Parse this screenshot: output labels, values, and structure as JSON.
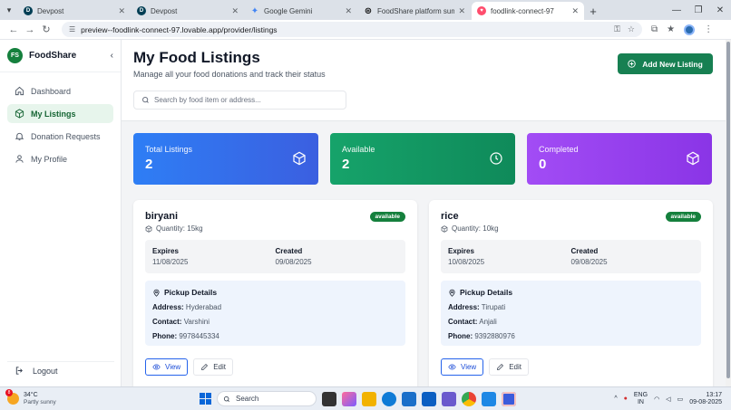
{
  "browser": {
    "tabs": [
      {
        "label": "Devpost",
        "icon": "devpost-icon",
        "color": "#003e54",
        "active": false
      },
      {
        "label": "Devpost",
        "icon": "devpost-icon",
        "color": "#003e54",
        "active": false
      },
      {
        "label": "Google Gemini",
        "icon": "gemini-icon",
        "color": "#4285f4",
        "active": false
      },
      {
        "label": "FoodShare platform summary",
        "icon": "chatgpt-icon",
        "color": "#111111",
        "active": false
      },
      {
        "label": "foodlink-connect-97",
        "icon": "lovable-icon",
        "color": "#ff4d6d",
        "active": true
      }
    ],
    "url": "preview--foodlink-connect-97.lovable.app/provider/listings"
  },
  "sidebar": {
    "brand_initials": "FS",
    "brand_name": "FoodShare",
    "items": [
      {
        "label": "Dashboard",
        "icon": "home-icon",
        "active": false
      },
      {
        "label": "My Listings",
        "icon": "box-icon",
        "active": true
      },
      {
        "label": "Donation Requests",
        "icon": "bell-icon",
        "active": false
      },
      {
        "label": "My Profile",
        "icon": "user-icon",
        "active": false
      }
    ],
    "logout_label": "Logout"
  },
  "header": {
    "title": "My Food Listings",
    "subtitle": "Manage all your food donations and track their status",
    "add_button_label": "Add New Listing",
    "search_placeholder": "Search by food item or address..."
  },
  "stats": [
    {
      "label": "Total Listings",
      "value": "2",
      "icon": "box-icon",
      "color": "#2e7ef5"
    },
    {
      "label": "Available",
      "value": "2",
      "icon": "clock-icon",
      "color": "#16a36a"
    },
    {
      "label": "Completed",
      "value": "0",
      "icon": "box-icon",
      "color": "#a24cf5"
    }
  ],
  "listings": [
    {
      "title": "biryani",
      "status": "available",
      "quantity": "Quantity: 15kg",
      "expires_label": "Expires",
      "expires": "11/08/2025",
      "created_label": "Created",
      "created": "09/08/2025",
      "pickup_heading": "Pickup Details",
      "address_label": "Address:",
      "address": "Hyderabad",
      "contact_label": "Contact:",
      "contact": "Varshini",
      "phone_label": "Phone:",
      "phone": "9978445334",
      "view_label": "View",
      "edit_label": "Edit"
    },
    {
      "title": "rice",
      "status": "available",
      "quantity": "Quantity: 10kg",
      "expires_label": "Expires",
      "expires": "10/08/2025",
      "created_label": "Created",
      "created": "09/08/2025",
      "pickup_heading": "Pickup Details",
      "address_label": "Address:",
      "address": "Tirupati",
      "contact_label": "Contact:",
      "contact": "Anjali",
      "phone_label": "Phone:",
      "phone": "9392880976",
      "view_label": "View",
      "edit_label": "Edit"
    }
  ],
  "taskbar": {
    "weather_badge": "8",
    "temperature": "34°C",
    "weather_desc": "Partly sunny",
    "search_label": "Search",
    "lang_top": "ENG",
    "lang_bottom": "IN",
    "time": "13:17",
    "date": "09-08-2025"
  }
}
